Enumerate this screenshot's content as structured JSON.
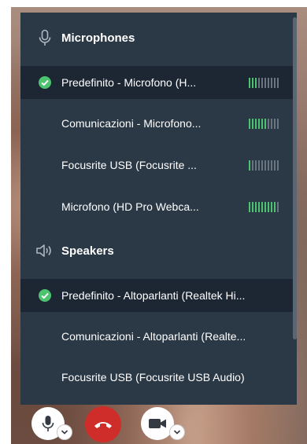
{
  "microphones": {
    "title": "Microphones",
    "icon": "microphone-icon",
    "items": [
      {
        "label": "Predefinito - Microfono (H...",
        "selected": true,
        "level": 0.3
      },
      {
        "label": "Comunicazioni - Microfono...",
        "selected": false,
        "level": 0.6
      },
      {
        "label": "Focusrite USB (Focusrite ...",
        "selected": false,
        "level": 0.1
      },
      {
        "label": "Microfono (HD Pro Webca...",
        "selected": false,
        "level": 0.9
      }
    ]
  },
  "speakers": {
    "title": "Speakers",
    "icon": "speaker-icon",
    "items": [
      {
        "label": "Predefinito - Altoparlanti (Realtek Hi...",
        "selected": true
      },
      {
        "label": "Comunicazioni - Altoparlanti (Realte...",
        "selected": false
      },
      {
        "label": "Focusrite USB (Focusrite USB Audio)",
        "selected": false
      }
    ]
  },
  "controls": {
    "mic_button": "microphone-icon",
    "end_call_button": "phone-hangup-icon",
    "camera_button": "video-camera-icon"
  },
  "colors": {
    "panel_bg": "#2b3845",
    "selected_row_bg": "#1d2733",
    "accent_green": "#4cc36f",
    "meter_off": "#6b7580",
    "end_call_red": "#cf2d2a"
  }
}
